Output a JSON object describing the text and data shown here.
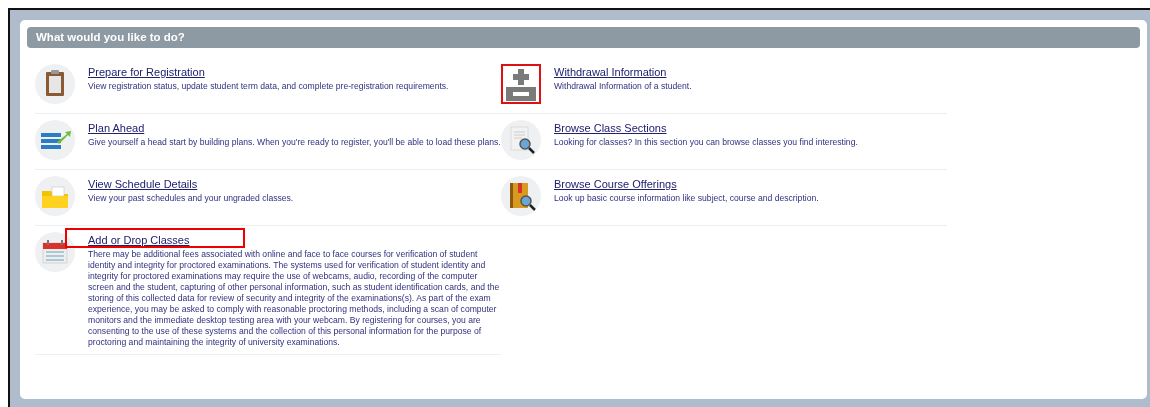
{
  "panel": {
    "title": "What would you like to do?"
  },
  "columns": [
    {
      "items": [
        {
          "kind": "clipboard",
          "highlighted": false,
          "title": "Prepare for Registration",
          "description": "View registration status, update student term data, and complete pre-registration requirements."
        },
        {
          "kind": "plan",
          "highlighted": false,
          "title": "Plan Ahead",
          "description": "Give yourself a head start by building plans. When you're ready to register, you'll be able to load these plans."
        },
        {
          "kind": "folder",
          "highlighted": false,
          "title": "View Schedule Details",
          "description": "View your past schedules and your ungraded classes."
        },
        {
          "kind": "calendar",
          "highlighted": true,
          "title": "Add or Drop Classes",
          "description": "There may be additional fees associated with online and face to face courses for verification of student identity and integrity for proctored examinations. The systems used for verification of student identity and integrity for proctored examinations may require the use of webcams, audio, recording of the computer screen and the student, capturing of other personal information, such as student identification cards, and the storing of this collected data for review of security and integrity of the examinations(s). As part of the exam experience, you may be asked to comply with reasonable proctoring methods, including a scan of computer monitors and the immediate desktop testing area with your webcam. By registering for courses, you are consenting to the use of these systems and the collection of this personal information for the purpose of proctoring and maintaining the integrity of university examinations."
        }
      ]
    },
    {
      "items": [
        {
          "kind": "plusminus",
          "highlighted": true,
          "title": "Withdrawal Information",
          "description": "Withdrawal Information of a student."
        },
        {
          "kind": "docsearch",
          "highlighted": false,
          "title": "Browse Class Sections",
          "description": "Looking for classes? In this section you can browse classes you find interesting."
        },
        {
          "kind": "booksearch",
          "highlighted": false,
          "title": "Browse Course Offerings",
          "description": "Look up basic course information like subject, course and description."
        }
      ]
    }
  ]
}
